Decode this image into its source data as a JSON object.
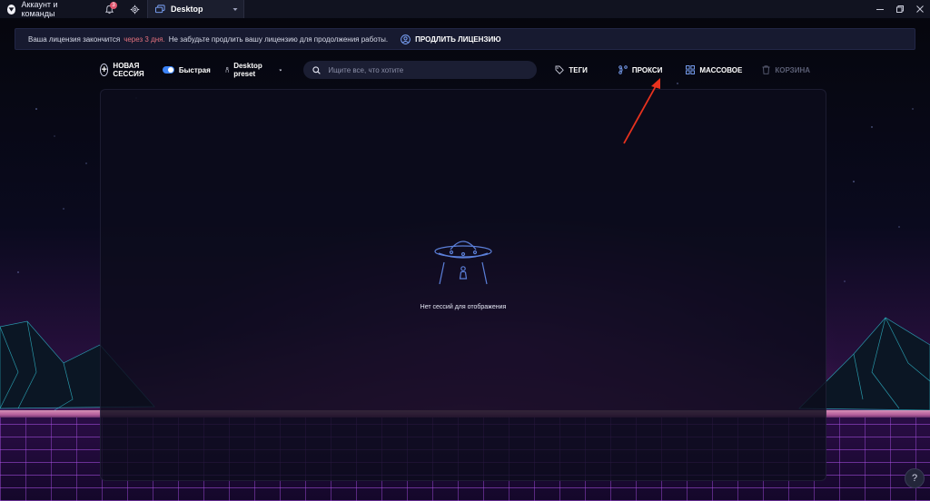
{
  "titlebar": {
    "account_tab": "Аккаунт и команды",
    "notification_count": "3",
    "desktop_tab": "Desktop"
  },
  "banner": {
    "text_before": "Ваша лицензия закончится",
    "warn_text": "через 3 дня.",
    "text_after": "Не забудьте продлить вашу лицензию для продолжения работы.",
    "renew_label": "ПРОДЛИТЬ ЛИЦЕНЗИЮ"
  },
  "toolbar": {
    "new_session": "НОВАЯ СЕССИЯ",
    "fast_label": "Быстрая",
    "fast_enabled": true,
    "preset_label": "Desktop preset",
    "search_placeholder": "Ищите все, что хотите",
    "tags": "ТЕГИ",
    "proxy": "ПРОКСИ",
    "bulk": "МАССОВОЕ",
    "trash": "КОРЗИНА"
  },
  "main": {
    "empty_text": "Нет сессий для отображения"
  },
  "help": {
    "label": "?"
  },
  "colors": {
    "accent": "#3b82f6",
    "warning": "#e1707c",
    "annotation_arrow": "#e8321e"
  }
}
